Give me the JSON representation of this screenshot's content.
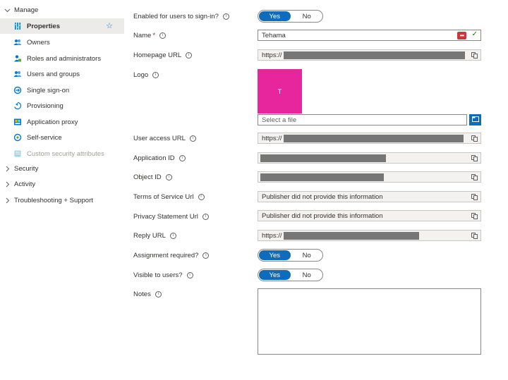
{
  "sidebar": {
    "manage_label": "Manage",
    "items": [
      {
        "label": "Properties",
        "icon": "properties-icon"
      },
      {
        "label": "Owners",
        "icon": "owners-icon"
      },
      {
        "label": "Roles and administrators",
        "icon": "roles-icon"
      },
      {
        "label": "Users and groups",
        "icon": "users-groups-icon"
      },
      {
        "label": "Single sign-on",
        "icon": "sso-icon"
      },
      {
        "label": "Provisioning",
        "icon": "provisioning-icon"
      },
      {
        "label": "Application proxy",
        "icon": "app-proxy-icon"
      },
      {
        "label": "Self-service",
        "icon": "self-service-icon"
      },
      {
        "label": "Custom security attributes",
        "icon": "custom-attributes-icon"
      }
    ],
    "groups": [
      {
        "label": "Security"
      },
      {
        "label": "Activity"
      },
      {
        "label": "Troubleshooting + Support"
      }
    ]
  },
  "form": {
    "enabled_label": "Enabled for users to sign-in?",
    "name_label": "Name",
    "name_required_marker": "*",
    "name_value": "Tehama",
    "homepage_label": "Homepage URL",
    "homepage_value": "https://",
    "logo_label": "Logo",
    "logo_letter": "T",
    "logo_placeholder": "Select a file",
    "user_access_label": "User access URL",
    "user_access_value": "https://",
    "app_id_label": "Application ID",
    "object_id_label": "Object ID",
    "tos_label": "Terms of Service Url",
    "tos_value": "Publisher did not provide this information",
    "privacy_label": "Privacy Statement Url",
    "privacy_value": "Publisher did not provide this information",
    "reply_label": "Reply URL",
    "reply_value": "https://",
    "assignment_label": "Assignment required?",
    "visible_label": "Visible to users?",
    "notes_label": "Notes",
    "toggle_yes": "Yes",
    "toggle_no": "No"
  },
  "colors": {
    "accent": "#0f6cbd",
    "logo_bg": "#e3008c",
    "active_nav": "#edebe9"
  }
}
